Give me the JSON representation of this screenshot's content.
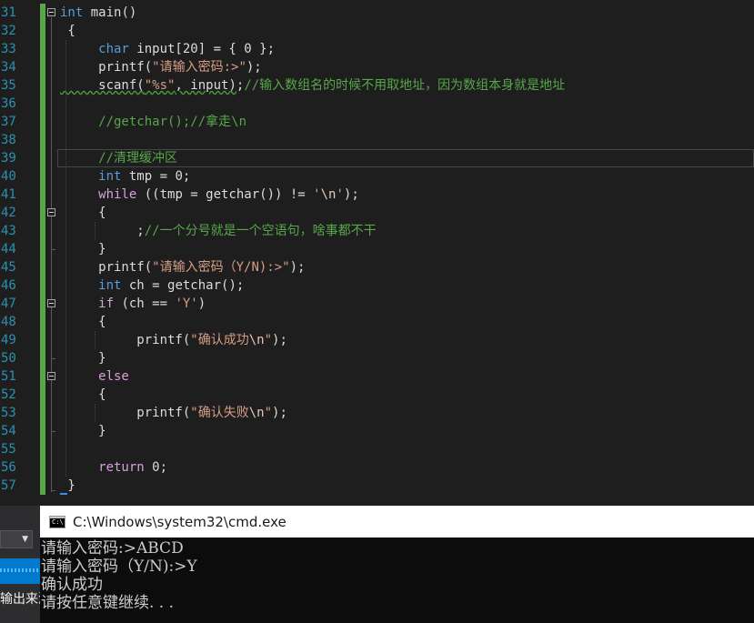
{
  "editor": {
    "line_numbers": [
      "31",
      "32",
      "33",
      "34",
      "35",
      "36",
      "37",
      "38",
      "39",
      "40",
      "41",
      "42",
      "43",
      "44",
      "45",
      "46",
      "47",
      "48",
      "49",
      "50",
      "51",
      "52",
      "53",
      "54",
      "55",
      "56",
      "57"
    ],
    "lines": [
      {
        "n": "31",
        "tokens": [
          {
            "t": "int",
            "c": "kw"
          },
          {
            "t": " main()",
            "c": ""
          }
        ]
      },
      {
        "n": "32",
        "tokens": [
          {
            "t": " {",
            "c": ""
          }
        ]
      },
      {
        "n": "33",
        "tokens": [
          {
            "t": "     char",
            "c": "kw"
          },
          {
            "t": " input[20] = { 0 };",
            "c": ""
          }
        ]
      },
      {
        "n": "34",
        "tokens": [
          {
            "t": "     printf(",
            "c": ""
          },
          {
            "t": "\"请输入密码:>\"",
            "c": "str"
          },
          {
            "t": ");",
            "c": ""
          }
        ]
      },
      {
        "n": "35",
        "tokens": [
          {
            "t": "     scanf(",
            "c": "sq"
          },
          {
            "t": "\"%s\"",
            "c": "strsq"
          },
          {
            "t": ", input)",
            "c": "sq"
          },
          {
            "t": ";",
            "c": ""
          },
          {
            "t": "//输入数组名的时候不用取地址，因为数组本身就是地址",
            "c": "cm"
          }
        ]
      },
      {
        "n": "36",
        "tokens": [
          {
            "t": "",
            "c": ""
          }
        ]
      },
      {
        "n": "37",
        "tokens": [
          {
            "t": "     //getchar();//拿走\\n",
            "c": "cm"
          }
        ]
      },
      {
        "n": "38",
        "tokens": [
          {
            "t": "",
            "c": ""
          }
        ]
      },
      {
        "n": "39",
        "tokens": [
          {
            "t": "     //清理缓冲区",
            "c": "cm"
          }
        ]
      },
      {
        "n": "40",
        "tokens": [
          {
            "t": "     int",
            "c": "kw"
          },
          {
            "t": " tmp = 0;",
            "c": ""
          }
        ]
      },
      {
        "n": "41",
        "tokens": [
          {
            "t": "     while",
            "c": "ctl"
          },
          {
            "t": " ((tmp = getchar()) != ",
            "c": ""
          },
          {
            "t": "'",
            "c": "str"
          },
          {
            "t": "\\n",
            "c": "esc"
          },
          {
            "t": "'",
            "c": "str"
          },
          {
            "t": ");",
            "c": ""
          }
        ]
      },
      {
        "n": "42",
        "tokens": [
          {
            "t": "     {",
            "c": ""
          }
        ]
      },
      {
        "n": "43",
        "tokens": [
          {
            "t": "          ;",
            "c": ""
          },
          {
            "t": "//一个分号就是一个空语句，啥事都不干",
            "c": "cm"
          }
        ]
      },
      {
        "n": "44",
        "tokens": [
          {
            "t": "     }",
            "c": ""
          }
        ]
      },
      {
        "n": "45",
        "tokens": [
          {
            "t": "     printf(",
            "c": ""
          },
          {
            "t": "\"请输入密码（Y/N):>\"",
            "c": "str"
          },
          {
            "t": ");",
            "c": ""
          }
        ]
      },
      {
        "n": "46",
        "tokens": [
          {
            "t": "     int",
            "c": "kw"
          },
          {
            "t": " ch = getchar();",
            "c": ""
          }
        ]
      },
      {
        "n": "47",
        "tokens": [
          {
            "t": "     if",
            "c": "ctl"
          },
          {
            "t": " (ch == ",
            "c": ""
          },
          {
            "t": "'Y'",
            "c": "str"
          },
          {
            "t": ")",
            "c": ""
          }
        ]
      },
      {
        "n": "48",
        "tokens": [
          {
            "t": "     {",
            "c": ""
          }
        ]
      },
      {
        "n": "49",
        "tokens": [
          {
            "t": "          printf(",
            "c": ""
          },
          {
            "t": "\"确认成功",
            "c": "str"
          },
          {
            "t": "\\n",
            "c": "esc"
          },
          {
            "t": "\"",
            "c": "str"
          },
          {
            "t": ");",
            "c": ""
          }
        ]
      },
      {
        "n": "50",
        "tokens": [
          {
            "t": "     }",
            "c": ""
          }
        ]
      },
      {
        "n": "51",
        "tokens": [
          {
            "t": "     else",
            "c": "ctl"
          }
        ]
      },
      {
        "n": "52",
        "tokens": [
          {
            "t": "     {",
            "c": ""
          }
        ]
      },
      {
        "n": "53",
        "tokens": [
          {
            "t": "          printf(",
            "c": ""
          },
          {
            "t": "\"确认失败",
            "c": "str"
          },
          {
            "t": "\\n",
            "c": "esc"
          },
          {
            "t": "\"",
            "c": "str"
          },
          {
            "t": ");",
            "c": ""
          }
        ]
      },
      {
        "n": "54",
        "tokens": [
          {
            "t": "     }",
            "c": ""
          }
        ]
      },
      {
        "n": "55",
        "tokens": [
          {
            "t": "",
            "c": ""
          }
        ]
      },
      {
        "n": "56",
        "tokens": [
          {
            "t": "     return",
            "c": "ctl"
          },
          {
            "t": " 0;",
            "c": ""
          }
        ]
      },
      {
        "n": "57",
        "tokens": [
          {
            "t": " }",
            "c": ""
          }
        ]
      }
    ],
    "current_line": "39"
  },
  "left_strip": {
    "text": "输出来源"
  },
  "console": {
    "title": "C:\\Windows\\system32\\cmd.exe",
    "icon_label": "C:\\",
    "output": [
      "请输入密码:>ABCD",
      "请输入密码（Y/N):>Y",
      "确认成功",
      "请按任意键继续. . ."
    ]
  },
  "colors": {
    "editor_bg": "#1e1e1e",
    "line_number": "#2b91af",
    "keyword": "#569cd6",
    "control_keyword": "#d8a0df",
    "string": "#d69d85",
    "comment": "#57a64a",
    "change_bar": "#57a64a",
    "console_bg": "#0c0c0c"
  },
  "icons": [
    "fold-collapse-icon",
    "cmd-icon",
    "dropdown-chevron-icon"
  ]
}
